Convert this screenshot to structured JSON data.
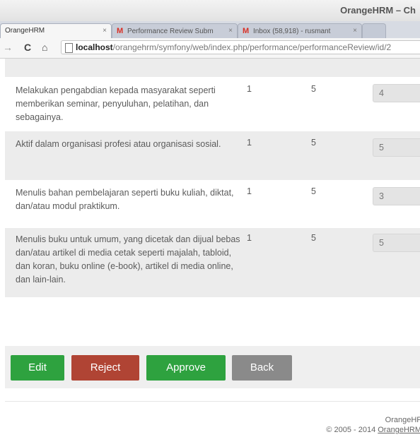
{
  "window": {
    "title": "OrangeHRM – Ch"
  },
  "tabs": [
    {
      "label": "OrangeHRM",
      "close": "×"
    },
    {
      "label": "Performance Review Subm",
      "close": "×"
    },
    {
      "label": "Inbox (58,918) - rusmant",
      "close": "×"
    }
  ],
  "address": {
    "host": "localhost",
    "path": "/orangehrm/symfony/web/index.php/performance/performanceReview/id/2"
  },
  "icons": {
    "back": "arrow-left-icon",
    "reload": "reload-icon",
    "home": "home-icon",
    "page": "page-icon",
    "gmail": "gmail-icon"
  },
  "rows": [
    {
      "desc": "Melakukan pengabdian kepada masyarakat seperti memberikan seminar, penyuluhan, pelatihan, dan sebagainya.",
      "min": "1",
      "max": "5",
      "score": "4"
    },
    {
      "desc": "Aktif dalam organisasi profesi atau organisasi sosial.",
      "min": "1",
      "max": "5",
      "score": "5"
    },
    {
      "desc": "Menulis bahan pembelajaran seperti buku kuliah, diktat, dan/atau modul praktikum.",
      "min": "1",
      "max": "5",
      "score": "3"
    },
    {
      "desc": "Menulis buku untuk umum, yang dicetak dan dijual bebas dan/atau artikel di media cetak seperti majalah, tabloid, dan koran, buku online (e-book), artikel di media online, dan lain-lain.",
      "min": "1",
      "max": "5",
      "score": "5"
    }
  ],
  "buttons": {
    "edit": "Edit",
    "reject": "Reject",
    "approve": "Approve",
    "back": "Back"
  },
  "colors": {
    "edit": "#2ea23f",
    "reject": "#b04434",
    "approve": "#2ea23f",
    "back": "#8a8a8a"
  },
  "footer": {
    "line1": "OrangeHF",
    "line2_prefix": "© 2005 - 2014 ",
    "line2_link": "OrangeHRM"
  }
}
